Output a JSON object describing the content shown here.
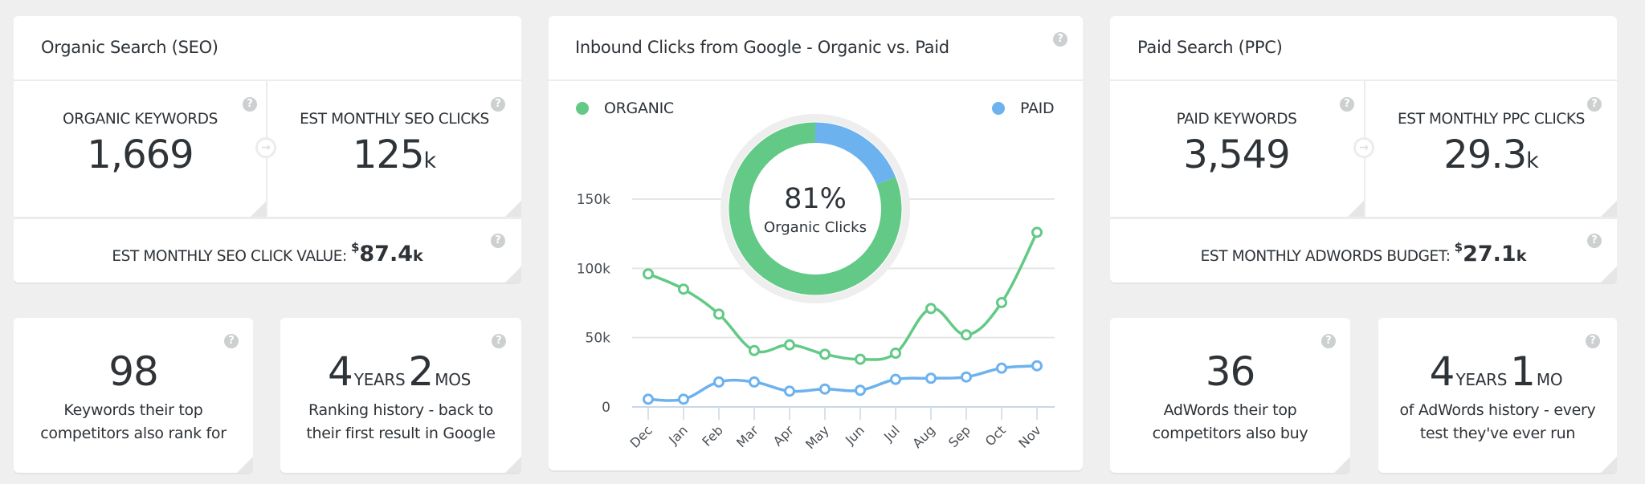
{
  "seo": {
    "title": "Organic Search (SEO)",
    "organic_keywords": {
      "label": "ORGANIC KEYWORDS",
      "value": "1,669"
    },
    "seo_clicks": {
      "label": "EST MONTHLY SEO CLICKS",
      "value": "125",
      "unit": "k"
    },
    "click_value": {
      "label": "EST MONTHLY SEO CLICK VALUE:",
      "currency": "$",
      "value": "87.4",
      "unit": "k"
    }
  },
  "ppc": {
    "title": "Paid Search (PPC)",
    "paid_keywords": {
      "label": "PAID KEYWORDS",
      "value": "3,549"
    },
    "ppc_clicks": {
      "label": "EST MONTHLY PPC CLICKS",
      "value": "29.3",
      "unit": "k"
    },
    "budget": {
      "label": "EST MONTHLY ADWORDS BUDGET:",
      "currency": "$",
      "value": "27.1",
      "unit": "k"
    }
  },
  "bottom_cards": [
    {
      "value": "98",
      "desc_line1": "Keywords their top",
      "desc_line2": "competitors also rank for"
    },
    {
      "years": "4",
      "years_unit": "YEARS",
      "months": "2",
      "months_unit": "MOS",
      "desc_line1": "Ranking history - back to",
      "desc_line2": "their first result in Google"
    },
    {
      "value": "36",
      "desc_line1": "AdWords their top",
      "desc_line2": "competitors also buy"
    },
    {
      "years": "4",
      "years_unit": "YEARS",
      "months": "1",
      "months_unit": "MO",
      "desc_line1": "of AdWords history - every",
      "desc_line2": "test they've ever run"
    }
  ],
  "help_icon": "?",
  "arrow_icon": "→",
  "colors": {
    "organic": "#63c986",
    "paid": "#6cb2ef"
  },
  "chart_data": {
    "type": "line",
    "title": "Inbound Clicks from Google - Organic vs. Paid",
    "xlabel": "",
    "ylabel": "",
    "categories": [
      "Dec",
      "Jan",
      "Feb",
      "Mar",
      "Apr",
      "May",
      "Jun",
      "Jul",
      "Aug",
      "Sep",
      "Oct",
      "Nov"
    ],
    "series": [
      {
        "name": "ORGANIC",
        "color": "#63c986",
        "values": [
          96000,
          85000,
          67000,
          40700,
          44800,
          38000,
          34400,
          38800,
          71000,
          52000,
          75300,
          126000
        ]
      },
      {
        "name": "PAID",
        "color": "#6cb2ef",
        "values": [
          5600,
          5600,
          18000,
          18000,
          11400,
          12900,
          12000,
          19900,
          20700,
          21600,
          28000,
          29700
        ]
      }
    ],
    "yticks": [
      0,
      50000,
      100000,
      150000
    ],
    "ytick_labels": [
      "0",
      "50k",
      "100k",
      "150k"
    ],
    "ylim": [
      0,
      150000
    ],
    "grid": true,
    "legend": "top",
    "donut": {
      "type": "pie",
      "labels": [
        "ORGANIC",
        "PAID"
      ],
      "values": [
        81,
        19
      ],
      "center_value": "81%",
      "center_label": "Organic Clicks"
    }
  }
}
